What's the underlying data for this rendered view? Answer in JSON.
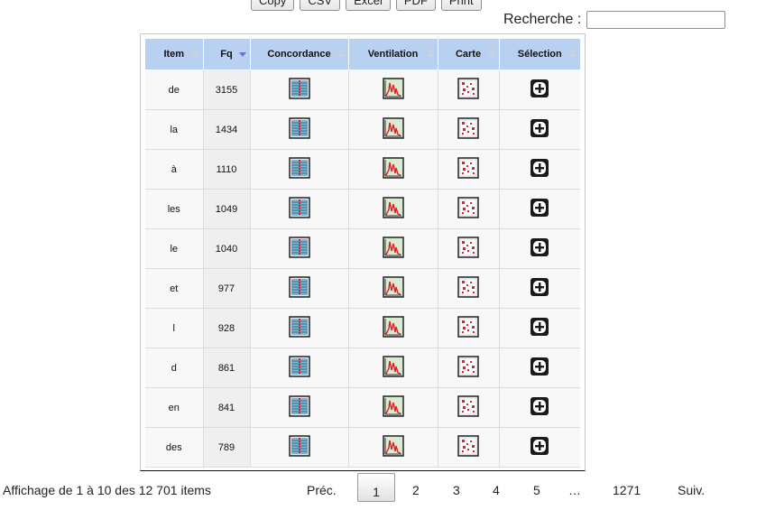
{
  "toolbar": {
    "copy": "Copy",
    "csv": "CSV",
    "excel": "Excel",
    "pdf": "PDF",
    "print": "Print"
  },
  "search": {
    "label": "Recherche :",
    "value": ""
  },
  "table": {
    "headers": {
      "item": "Item",
      "fq": "Fq",
      "concordance": "Concordance",
      "ventilation": "Ventilation",
      "carte": "Carte",
      "selection": "Sélection"
    },
    "sorted_column": "Fq",
    "rows": [
      {
        "item": "de",
        "fq": "3155"
      },
      {
        "item": "la",
        "fq": "1434"
      },
      {
        "item": "à",
        "fq": "1110"
      },
      {
        "item": "les",
        "fq": "1049"
      },
      {
        "item": "le",
        "fq": "1040"
      },
      {
        "item": "et",
        "fq": "977"
      },
      {
        "item": "l",
        "fq": "928"
      },
      {
        "item": "d",
        "fq": "861"
      },
      {
        "item": "en",
        "fq": "841"
      },
      {
        "item": "des",
        "fq": "789"
      }
    ],
    "icons": {
      "concordance": "concordance-icon",
      "ventilation": "ventilation-graph-icon",
      "carte": "map-icon",
      "selection": "add-selection-icon"
    },
    "colors": {
      "header": "#b8d1f1",
      "accent_red": "#e0202a"
    }
  },
  "footer": {
    "info": "Affichage de 1 à 10 des 12 701 items",
    "pagination": {
      "prev": "Préc.",
      "pages": [
        "1",
        "2",
        "3",
        "4",
        "5"
      ],
      "ellipsis": "…",
      "last": "1271",
      "next": "Suiv.",
      "current": "1"
    }
  }
}
